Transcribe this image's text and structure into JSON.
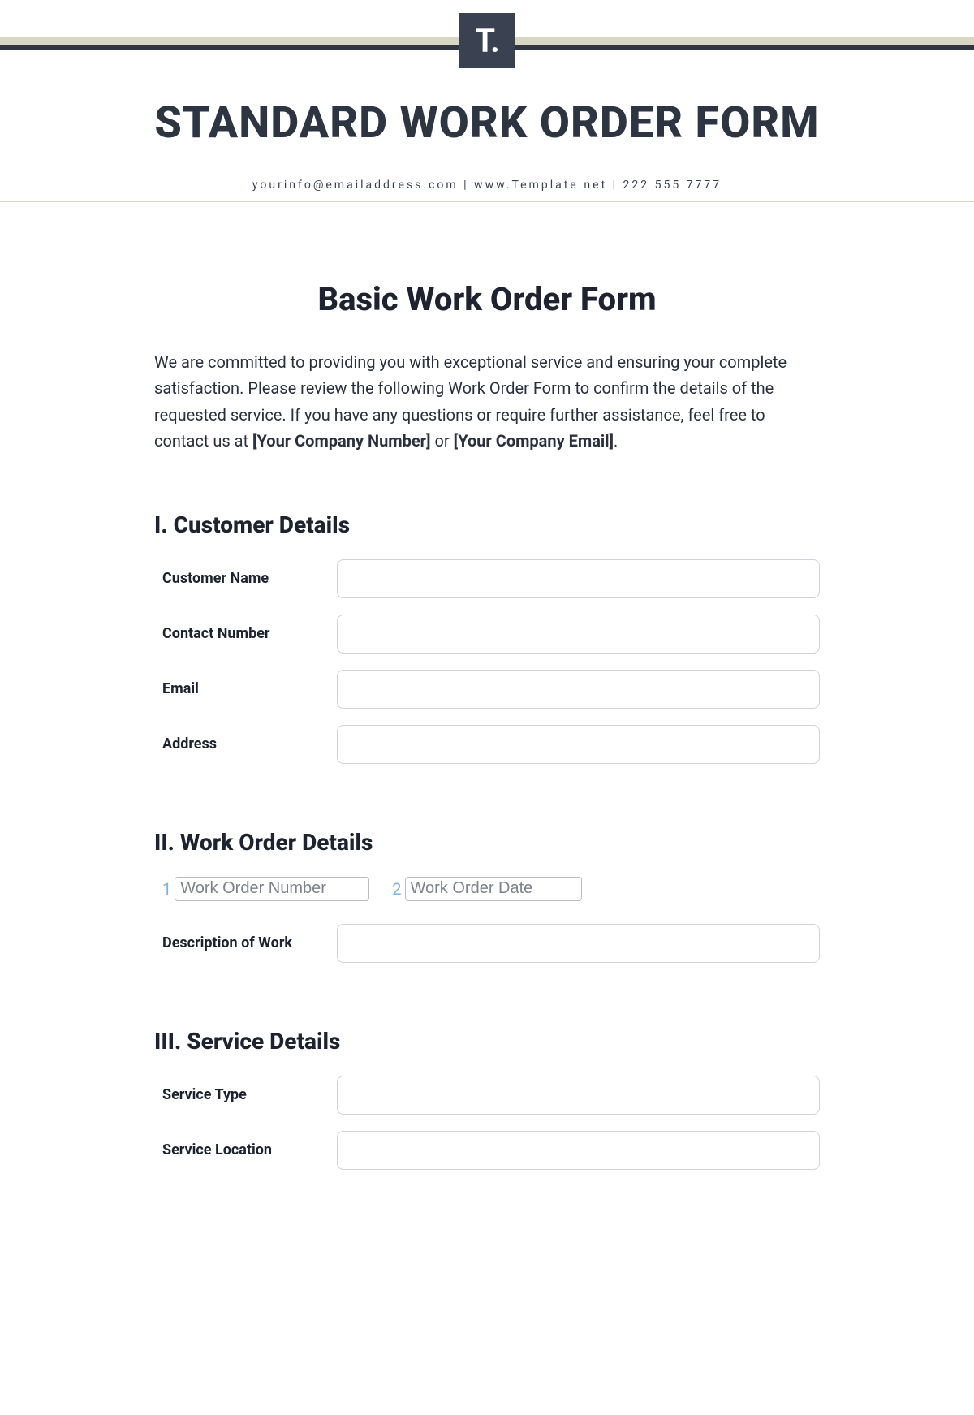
{
  "header": {
    "logo_text": "T.",
    "big_title": "STANDARD WORK ORDER FORM",
    "contact_line": "yourinfo@emailaddress.com | www.Template.net | 222 555 7777"
  },
  "form": {
    "title": "Basic Work Order Form",
    "intro_1": "We are committed to providing you with exceptional service and ensuring your complete satisfaction. Please review the following Work Order Form to confirm the details of the requested service. If you have any questions or require further assistance, feel free to contact us at ",
    "ph_company_number": "[Your Company Number]",
    "intro_or": " or ",
    "ph_company_email": "[Your Company Email]",
    "intro_end": "."
  },
  "sections": {
    "customer": {
      "heading": "I. Customer Details",
      "fields": {
        "name_label": "Customer Name",
        "contact_label": "Contact Number",
        "email_label": "Email",
        "address_label": "Address"
      }
    },
    "work_order": {
      "heading": "II. Work Order Details",
      "num_index": "1",
      "num_placeholder": "Work Order Number",
      "date_index": "2",
      "date_placeholder": "Work Order Date",
      "desc_label": "Description of Work"
    },
    "service": {
      "heading": "III. Service Details",
      "type_label": "Service Type",
      "location_label": "Service Location"
    }
  }
}
